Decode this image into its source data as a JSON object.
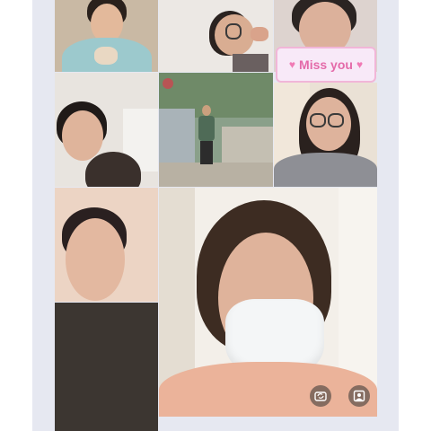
{
  "call": {
    "sticker_text": "Miss you",
    "sticker_heart_left": "♥",
    "sticker_heart_right": "♥"
  },
  "participants": [
    {
      "tile": "top-left",
      "description_icon": "video-feed"
    },
    {
      "tile": "top-center",
      "description_icon": "video-feed"
    },
    {
      "tile": "top-right",
      "description_icon": "video-feed"
    },
    {
      "tile": "middle-left",
      "description_icon": "video-feed"
    },
    {
      "tile": "middle-center",
      "description_icon": "video-feed"
    },
    {
      "tile": "middle-right",
      "description_icon": "video-feed"
    },
    {
      "tile": "bottom-left",
      "description_icon": "video-feed"
    },
    {
      "tile": "bottom-left-empty",
      "description_icon": "video-off"
    },
    {
      "tile": "main-speaker",
      "description_icon": "video-feed"
    }
  ],
  "controls": {
    "switch_camera_icon": "camera-switch-icon",
    "effects_icon": "portrait-effect-icon"
  },
  "colors": {
    "sticker_text": "#e46aa9",
    "sticker_border": "#f1b6d8",
    "frame_background": "#e6e8f1"
  }
}
